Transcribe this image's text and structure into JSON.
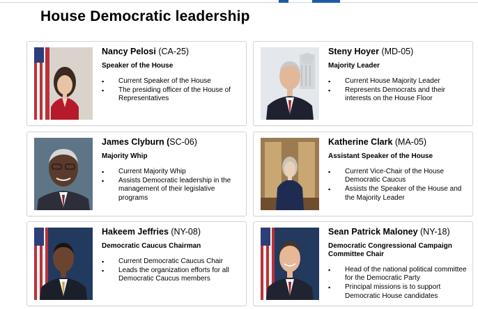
{
  "title": "House Democratic leadership",
  "leaders": [
    {
      "name": "Nancy Pelosi",
      "district": "(CA-25)",
      "role": "Speaker of the House",
      "bullets": [
        "Current Speaker of the House",
        "The presiding officer of the House of Representatives"
      ]
    },
    {
      "name": "Steny Hoyer",
      "district": "(MD-05)",
      "role": "Majority Leader",
      "bullets": [
        "Current House Majority Leader",
        "Represents Democrats and their interests on the House Floor"
      ]
    },
    {
      "name": "James Clyburn (",
      "district": "SC-06)",
      "role": "Majority Whip",
      "bullets": [
        "Current Majority Whip",
        "Assists Democratic leadership in the management of their legislative programs"
      ]
    },
    {
      "name": "Katherine Clark",
      "district": "(MA-05)",
      "role": "Assistant Speaker of the House",
      "bullets": [
        "Current Vice-Chair of the House Democratic Caucus",
        "Assists the Speaker of the House and the Majority Leader"
      ]
    },
    {
      "name": "Hakeem Jeffries",
      "district": "(NY-08)",
      "role": "Democratic Caucus Chairman",
      "bullets": [
        "Current Democratic Caucus Chair",
        "Leads the organization efforts for all Democratic Caucus members"
      ]
    },
    {
      "name": "Sean Patrick Maloney",
      "district": "(NY-18)",
      "role": "Democratic Congressional Campaign Committee Chair",
      "bullets": [
        "Head of the national political committee for the Democratic Party",
        "Principal missions is to support Democratic House candidates"
      ]
    }
  ],
  "colors": {
    "accent": "#1f5aa8",
    "card_border": "#d4d4d4"
  }
}
